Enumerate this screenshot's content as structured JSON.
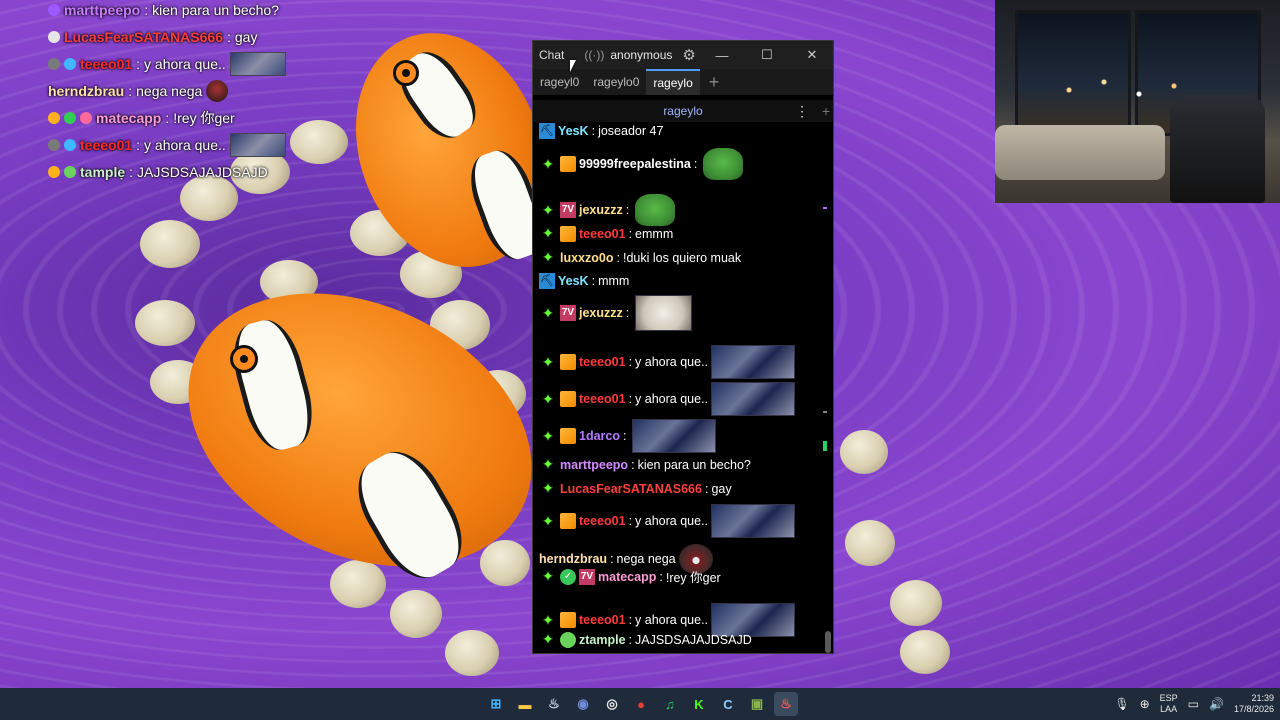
{
  "overlay_chat": [
    {
      "badges": [
        "#9b59ff"
      ],
      "user": "marttpeepo",
      "user_color": "#c77dff",
      "message": "kien para un becho?",
      "emote": null
    },
    {
      "badges": [
        "#e6e6e6"
      ],
      "user": "LucasFearSATANAS666",
      "user_color": "#ff3b3b",
      "message": "gay",
      "emote": null
    },
    {
      "badges": [
        "#7a7a7a",
        "#3fb8ff"
      ],
      "user": "teeeo01",
      "user_color": "#ff2b2b",
      "message": "y ahora que..",
      "emote": "crowd"
    },
    {
      "badges": [],
      "user": "herndzbrau",
      "user_color": "#ffe0b0",
      "message": "nega nega",
      "emote": "face"
    },
    {
      "badges": [
        "#ffb020",
        "#33cc55",
        "#ff6a9a"
      ],
      "user": "matecapp",
      "user_color": "#ff9ad5",
      "message": "!rey 你ger",
      "emote": null
    },
    {
      "badges": [
        "#7a7a7a",
        "#3fb8ff"
      ],
      "user": "teeeo01",
      "user_color": "#ff2b2b",
      "message": "y ahora que..",
      "emote": "crowd"
    },
    {
      "badges": [
        "#ffb020",
        "#6bd25b"
      ],
      "user": "tamplẹ",
      "user_color": "#c8f0c8",
      "message": "JAJSDSAJAJDSAJD",
      "emote": null
    }
  ],
  "chat_window": {
    "titlebar": {
      "title": "Chat",
      "live_icon": "((·))",
      "user": "anonymous",
      "gear": "⚙",
      "minimize": "—",
      "maximize": "☐",
      "close": "✕"
    },
    "tabs": [
      {
        "label": "rageyl0",
        "active": false
      },
      {
        "label": "rageylo0",
        "active": false
      },
      {
        "label": "rageylo",
        "active": true
      }
    ],
    "tab_add": "+",
    "split_header": {
      "channel": "rageylo",
      "menu": "⋮",
      "add": "+"
    }
  },
  "messages": [
    {
      "spark": false,
      "badges": [
        "pick"
      ],
      "user": "YesK",
      "user_color": "#7ee6ff",
      "text": "joseador 47",
      "emote": null
    },
    {
      "spark": true,
      "badges": [
        "sub"
      ],
      "user": "99999freepalestina",
      "user_color": "#ffffff",
      "text": "",
      "emote": "pepe"
    },
    {
      "spark": true,
      "badges": [
        "seven"
      ],
      "user": "jexuzzz",
      "user_color": "#ffe08a",
      "text": "",
      "emote": "pepe"
    },
    {
      "spark": true,
      "badges": [
        "sub"
      ],
      "user": "teeeo01",
      "user_color": "#ff3b3b",
      "text": "emmm",
      "emote": null
    },
    {
      "spark": true,
      "badges": [],
      "user": "luxxzo0o",
      "user_color": "#ffe08a",
      "text": "!duki los quiero muak",
      "emote": null
    },
    {
      "spark": false,
      "badges": [
        "pick"
      ],
      "user": "YesK",
      "user_color": "#7ee6ff",
      "text": "mmm",
      "emote": null
    },
    {
      "spark": true,
      "badges": [
        "seven"
      ],
      "user": "jexuzzz",
      "user_color": "#ffe08a",
      "text": "",
      "emote": "cat"
    },
    {
      "spark": true,
      "badges": [
        "sub"
      ],
      "user": "teeeo01",
      "user_color": "#ff3b3b",
      "text": "y ahora que..",
      "emote": "crowd"
    },
    {
      "spark": true,
      "badges": [
        "sub"
      ],
      "user": "teeeo01",
      "user_color": "#ff3b3b",
      "text": "y ahora que..",
      "emote": "crowd"
    },
    {
      "spark": true,
      "badges": [
        "sub"
      ],
      "user": "1darco",
      "user_color": "#b47bff",
      "text": "",
      "emote": "crowd"
    },
    {
      "spark": true,
      "badges": [],
      "user": "marttpeepo",
      "user_color": "#d28bff",
      "text": "kien para un becho?",
      "emote": null
    },
    {
      "spark": true,
      "badges": [],
      "user": "LucasFearSATANAS666",
      "user_color": "#ff4040",
      "text": "gay",
      "emote": null
    },
    {
      "spark": true,
      "badges": [
        "sub"
      ],
      "user": "teeeo01",
      "user_color": "#ff3b3b",
      "text": "y ahora que..",
      "emote": "crowd"
    },
    {
      "spark": false,
      "badges": [],
      "user": "herndzbrau",
      "user_color": "#ffe0b0",
      "text": "nega nega",
      "emote": "monster"
    },
    {
      "spark": true,
      "badges": [
        "ok",
        "seven"
      ],
      "user": "matecapp",
      "user_color": "#ff9ad5",
      "text": "!rey 你ger",
      "emote": null
    },
    {
      "spark": true,
      "badges": [
        "sub"
      ],
      "user": "teeeo01",
      "user_color": "#ff3b3b",
      "text": "y ahora que..",
      "emote": "crowd"
    },
    {
      "spark": true,
      "badges": [
        "frog"
      ],
      "user": "ztample",
      "user_color": "#c8f0c8",
      "text": "JAJSDSAJAJDSAJD",
      "emote": null
    }
  ],
  "taskbar": {
    "icons": [
      {
        "name": "windows-start-icon",
        "glyph": "⊞",
        "color": "#4ab3ff"
      },
      {
        "name": "file-explorer-icon",
        "glyph": "▬",
        "color": "#f7c948"
      },
      {
        "name": "steam-icon",
        "glyph": "♨",
        "color": "#cfd8e3"
      },
      {
        "name": "discord-icon",
        "glyph": "◉",
        "color": "#7289da"
      },
      {
        "name": "obs-icon",
        "glyph": "◎",
        "color": "#e8e8e8"
      },
      {
        "name": "chrome-icon",
        "glyph": "●",
        "color": "#e34133"
      },
      {
        "name": "spotify-icon",
        "glyph": "♫",
        "color": "#1ed760"
      },
      {
        "name": "kick-icon",
        "glyph": "K",
        "color": "#53fc18"
      },
      {
        "name": "chatterino-icon",
        "glyph": "C",
        "color": "#8ecbff"
      },
      {
        "name": "game-icon",
        "glyph": "▣",
        "color": "#8ab34a"
      },
      {
        "name": "steam-active-icon",
        "glyph": "♨",
        "color": "#ff5a5a"
      }
    ],
    "tray": {
      "lang_top": "ESP",
      "lang_bottom": "LAA",
      "time": "21:39",
      "date": "17/8/2026"
    }
  }
}
